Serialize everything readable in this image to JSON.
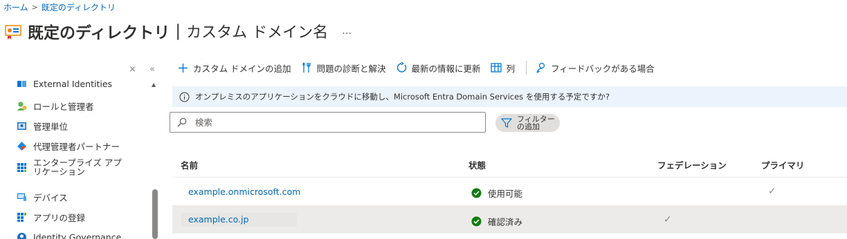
{
  "breadcrumb": {
    "home": "ホーム",
    "separator": ">",
    "current": "既定のディレクトリ"
  },
  "header": {
    "title": "既定のディレクトリ",
    "separator": "|",
    "subtitle": "カスタム ドメイン名",
    "more": "…"
  },
  "sidebar": {
    "close_glyph": "×",
    "collapse_glyph": "«",
    "items": [
      {
        "label": "External Identities",
        "icon": "external-identities-icon"
      },
      {
        "label": "ロールと管理者",
        "icon": "roles-admins-icon"
      },
      {
        "label": "管理単位",
        "icon": "admin-units-icon"
      },
      {
        "label": "代理管理者パートナー",
        "icon": "delegated-partners-icon"
      },
      {
        "label": "エンタープライズ アプリケーション",
        "icon": "enterprise-apps-icon"
      },
      {
        "label": "デバイス",
        "icon": "devices-icon"
      },
      {
        "label": "アプリの登録",
        "icon": "app-registrations-icon"
      },
      {
        "label": "Identity Governance",
        "icon": "identity-governance-icon"
      }
    ]
  },
  "toolbar": {
    "add_domain": "カスタム ドメインの追加",
    "diagnose": "問題の診断と解決",
    "refresh": "最新の情報に更新",
    "columns": "列",
    "feedback": "フィードバックがある場合"
  },
  "info_banner": {
    "text": "オンプレミスのアプリケーションをクラウドに移動し、Microsoft Entra Domain Services を使用する予定ですか?"
  },
  "search": {
    "placeholder": "検索"
  },
  "filter": {
    "label": "フィルターの追加"
  },
  "table": {
    "headers": {
      "name": "名前",
      "status": "状態",
      "federation": "フェデレーション",
      "primary": "プライマリ"
    },
    "rows": [
      {
        "name": "example.onmicrosoft.com",
        "status": "使用可能",
        "federation": "",
        "primary": "✓"
      },
      {
        "name": "example.co.jp",
        "status": "確認済み",
        "federation": "✓",
        "primary": ""
      }
    ]
  },
  "colors": {
    "accent": "#0067b8",
    "success": "#107c10",
    "banner": "#ebf3fc"
  }
}
